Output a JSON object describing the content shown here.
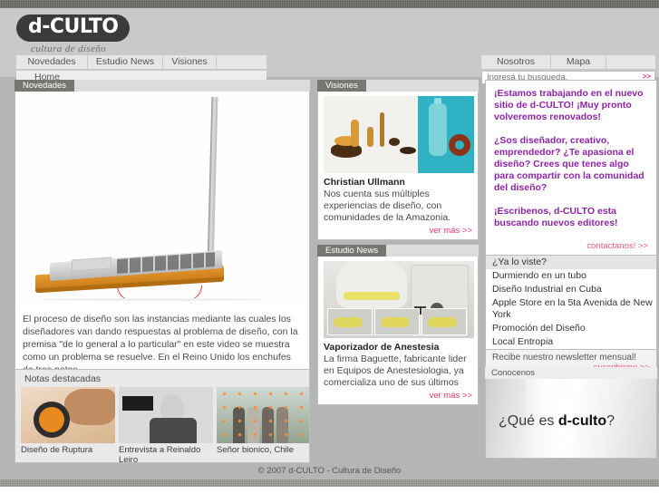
{
  "site": {
    "logo_text": "d-CULTO",
    "logo_tagline": "cultura de diseño"
  },
  "nav": {
    "left_tabs": [
      "Novedades",
      "Estudio News",
      "Visiones"
    ],
    "right_tabs": [
      "Nosotros",
      "Mapa"
    ],
    "home_label": "Home"
  },
  "search": {
    "placeholder": "Ingresá tu busqueda.",
    "value": "",
    "go_label": ">>"
  },
  "novedades": {
    "section_label": "Novedades",
    "body": "El proceso de diseño son las instancias mediante las cuales los diseñadores van dando respuestas al problema de diseño, con la premisa \"de lo general a lo particular\" en este video se muestra como un problema se resuelve. En el Reino Unido los enchufes de tres patas…",
    "controls": "◀|  |▶  ||"
  },
  "notas": {
    "title": "Notas destacadas",
    "items": [
      {
        "caption": "Diseño de Ruptura"
      },
      {
        "caption": "Entrevista a Reinaldo Leiro"
      },
      {
        "caption": "Señor bionico, Chile"
      }
    ]
  },
  "visiones": {
    "section_label": "Visiones",
    "title": "Christian Ullmann",
    "desc": "Nos cuenta sus múltiples experiencias de diseño, con comunidades de la Amazonia.",
    "more_label": "ver más  >>"
  },
  "estudio": {
    "section_label": "Estudio News",
    "title": "Vaporizador de Anestesia",
    "desc": "La firma Baguette, fabricante lider en Equipos de Anestesiologia, ya comercializa uno de sus últimos",
    "more_label": "ver más  >>"
  },
  "promo": {
    "p1": "¡Estamos trabajando en el nuevo sitio de d-CULTO! ¡Muy pronto volveremos renovados!",
    "p2": "¿Sos diseñador, creativo, emprendedor? ¿Te apasiona el diseño? Crees que tenes algo para compartir con la comunidad del diseño?",
    "p3": "¡Escribenos, d-CULTO esta buscando nuevos editores!",
    "contact_label": "contactanos!  >>"
  },
  "links": {
    "header": "¿Ya lo viste?",
    "items": [
      "Durmiendo en un tubo",
      "Diseño Industrial en Cuba",
      "Apple Store en la 5ta Avenida de New York",
      "Promoción del Diseño",
      "Local Entropia"
    ]
  },
  "newsletter": {
    "text": "Recibe nuestro newsletter mensual!",
    "link": "suscribirme  >>"
  },
  "conocenos": {
    "section_label": "Conocenos",
    "headline_pre": "¿Qué es ",
    "headline_brand": "d-culto",
    "headline_post": "?"
  },
  "footer": {
    "copyright": "© 2007 d-CULTO - Cultura de Diseño"
  },
  "colors": {
    "accent_pink": "#e8386e",
    "promo_purple": "#8e24a6",
    "page_bg": "#b5b5b5",
    "header_bg": "#c9c9c9"
  }
}
